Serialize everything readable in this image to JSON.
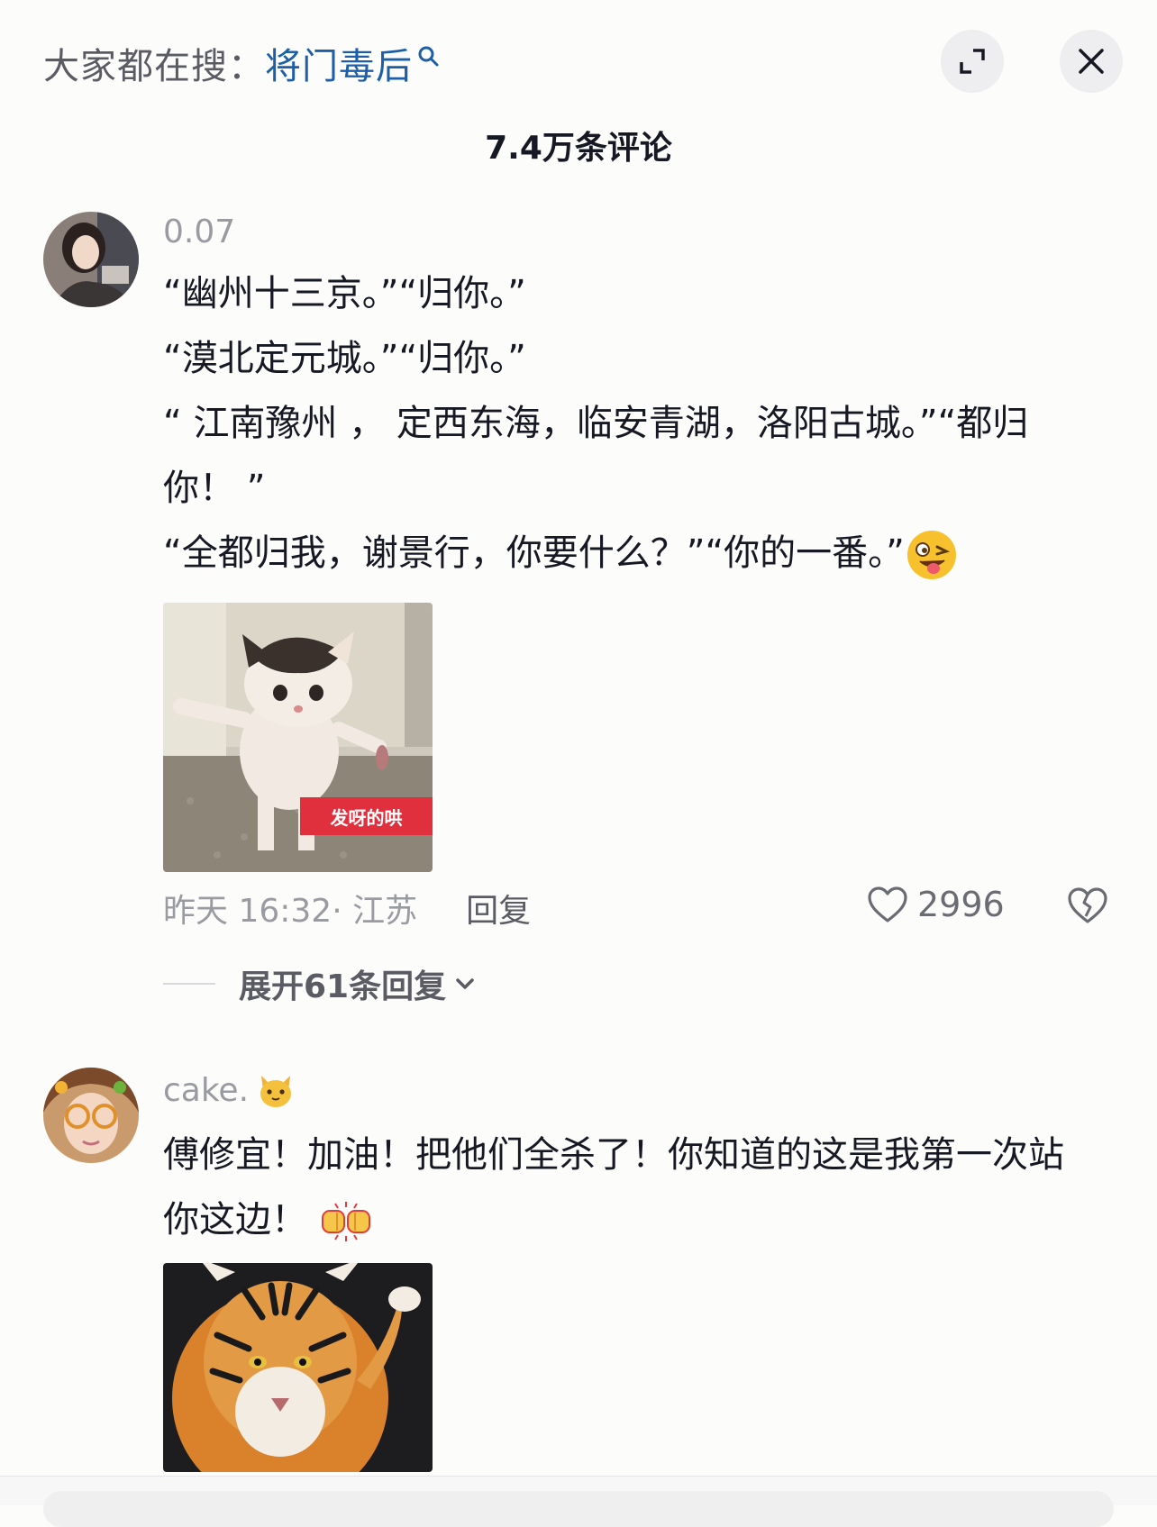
{
  "header": {
    "search_prefix": "大家都在搜：",
    "search_term": "将门毒后",
    "title": "7.4万条评论"
  },
  "comments": [
    {
      "username": "0.07",
      "lines": [
        "“幽州十三京。”“归你。”",
        "“漠北定元城。”“归你。”",
        "“ 江南豫州 ， 定西东海，临安青湖，洛阳古城。”“都归你！ ”",
        "“全都归我，谢景行，你要什么？”“你的一番。”"
      ],
      "emoji": "wink-tongue-emoji",
      "sticker_caption": "发呀的哄",
      "time": "昨天 16:32· 江苏",
      "reply_label": "回复",
      "likes": "2996",
      "expand_label": "展开61条回复"
    },
    {
      "username": "cake.",
      "username_emoji": "cat-face-emoji",
      "text": "傅修宜！加油！把他们全杀了！你知道的这是我第一次站你这边！",
      "emoji": "fist-bump-emoji"
    }
  ],
  "colors": {
    "accent_link": "#1c5fa8",
    "text_primary": "#161823",
    "text_secondary": "#9a9ba1",
    "sticker_tag": "#e0303e"
  }
}
